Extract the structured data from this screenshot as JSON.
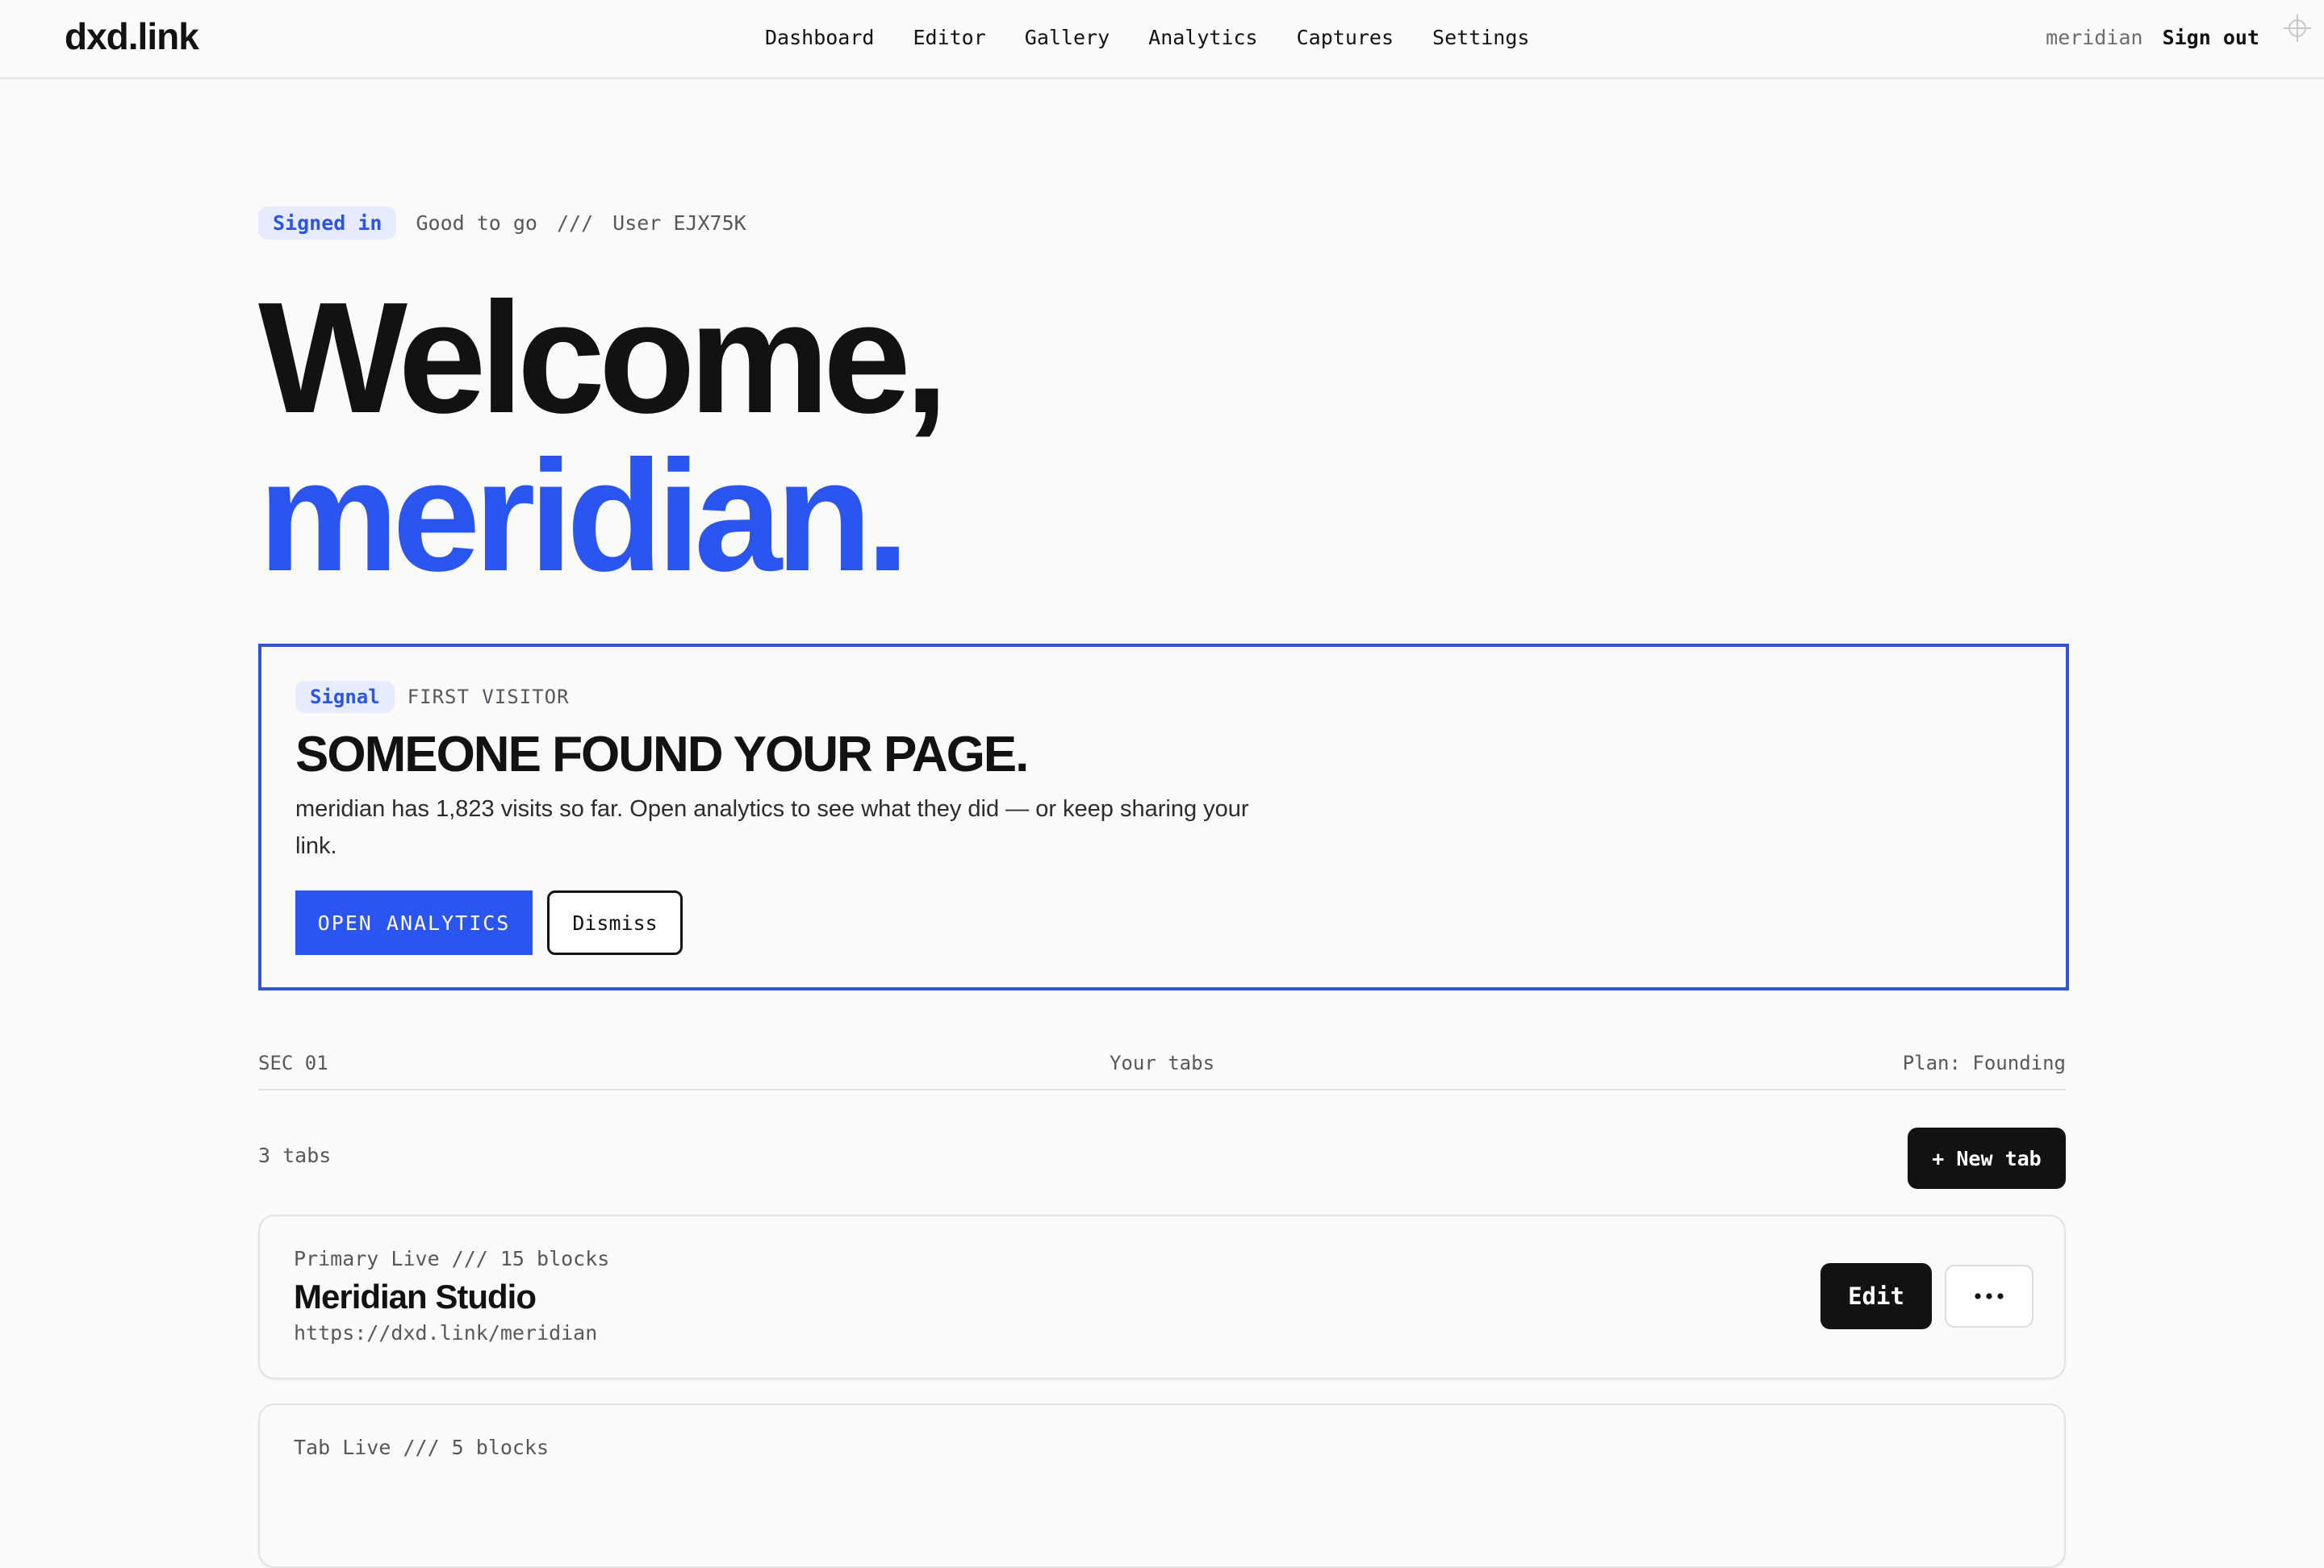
{
  "app": {
    "logo": "dxd.link"
  },
  "nav": {
    "items": [
      "Dashboard",
      "Editor",
      "Gallery",
      "Analytics",
      "Captures",
      "Settings"
    ]
  },
  "account": {
    "username": "meridian",
    "sign_out": "Sign out",
    "icon": "crosshair-icon"
  },
  "status": {
    "badge": "Signed in",
    "text": "Good to go",
    "separator": "///",
    "user": "User EJX75K"
  },
  "hero": {
    "line1": "Welcome,",
    "line2": "meridian."
  },
  "signal": {
    "badge": "Signal",
    "tag": "FIRST VISITOR",
    "title": "SOMEONE FOUND YOUR PAGE.",
    "body": "meridian has 1,823 visits so far. Open analytics to see what they did — or keep sharing your link.",
    "primary_button": "OPEN ANALYTICS",
    "secondary_button": "Dismiss"
  },
  "section": {
    "id": "SEC 01",
    "title": "Your tabs",
    "plan": "Plan: Founding"
  },
  "tabs": {
    "count_label": "3 tabs",
    "new_button": "+ New tab",
    "items": [
      {
        "meta": "Primary Live /// 15 blocks",
        "name": "Meridian Studio",
        "url": "https://dxd.link/meridian",
        "edit_label": "Edit",
        "more_icon": "more-horizontal-icon"
      },
      {
        "meta": "Tab Live /// 5 blocks"
      }
    ]
  },
  "colors": {
    "accent": "#2b55f0",
    "card_border": "#2f55d4",
    "badge_bg": "#e6ecfd",
    "text": "#111214",
    "muted": "#55585e",
    "background": "#fafaf9"
  }
}
